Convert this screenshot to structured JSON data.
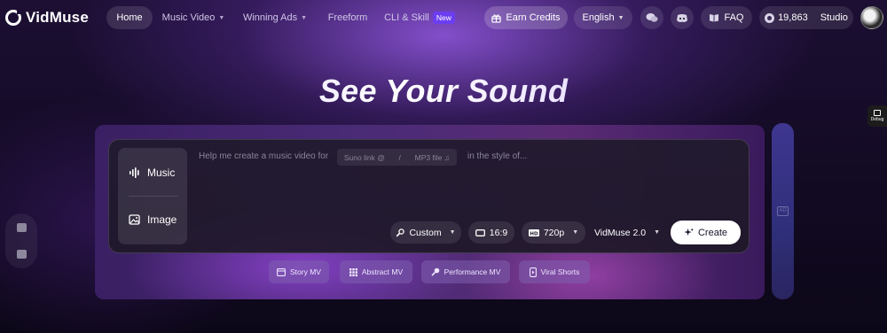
{
  "header": {
    "logo_text": "VidMuse",
    "nav": {
      "home": "Home",
      "music_video": "Music Video",
      "winning_ads": "Winning Ads",
      "freeform": "Freeform",
      "cli_skill": "CLI & Skill",
      "new_badge": "New"
    },
    "earn_credits": "Earn Credits",
    "language": "English",
    "faq": "FAQ",
    "credits": "19,863",
    "studio": "Studio"
  },
  "hero": {
    "title": "See Your Sound"
  },
  "composer": {
    "modes": {
      "music": "Music",
      "image": "Image"
    },
    "prompt_lead": "Help me create a music video for",
    "suno_link": "Suno link @",
    "separator": "/",
    "mp3_file": "MP3 file",
    "prompt_tail": "in the style of...",
    "controls": {
      "style": "Custom",
      "ratio": "16:9",
      "resolution": "720p",
      "model": "VidMuse 2.0",
      "create": "Create"
    }
  },
  "quick_actions": {
    "story": "Story MV",
    "abstract": "Abstract MV",
    "performance": "Performance MV",
    "viral": "Viral Shorts"
  },
  "debug": {
    "label": "Debug"
  },
  "colors": {
    "accent_purple": "#6c3df0",
    "create_button": "#ffffff",
    "quick_action_bg": "#7d5faf"
  },
  "icons": {
    "logo": "vidmuse-logo-icon",
    "earn": "gift-icon",
    "wechat": "wechat-icon",
    "discord": "discord-icon",
    "faq": "book-icon",
    "credits": "coin-icon",
    "music": "waveform-icon",
    "image": "image-plus-icon",
    "style": "wrench-icon",
    "ratio": "aspect-ratio-icon",
    "resolution": "hd-icon",
    "create": "sparkle-icon"
  }
}
